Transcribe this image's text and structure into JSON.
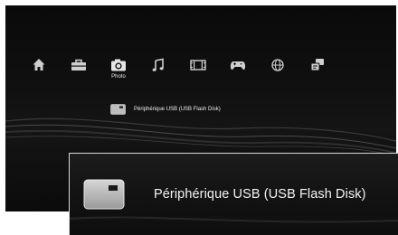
{
  "xmb": {
    "categories": [
      {
        "icon": "home-icon",
        "label": ""
      },
      {
        "icon": "toolbox-icon",
        "label": ""
      },
      {
        "icon": "camera-icon",
        "label": "Photo"
      },
      {
        "icon": "music-note-icon",
        "label": ""
      },
      {
        "icon": "film-icon",
        "label": ""
      },
      {
        "icon": "gamepad-icon",
        "label": ""
      },
      {
        "icon": "globe-icon",
        "label": ""
      },
      {
        "icon": "friends-icon",
        "label": ""
      }
    ],
    "selected": "Photo"
  },
  "device": {
    "icon": "usb-drive-icon",
    "label": "Périphérique USB (USB Flash Disk)"
  },
  "zoom": {
    "icon": "usb-drive-icon",
    "label": "Périphérique USB (USB Flash Disk)"
  },
  "colors": {
    "background": "#0e0e0e",
    "icon": "#cfcfcf",
    "text": "#f0f0f0",
    "frame": "#ffffff"
  }
}
